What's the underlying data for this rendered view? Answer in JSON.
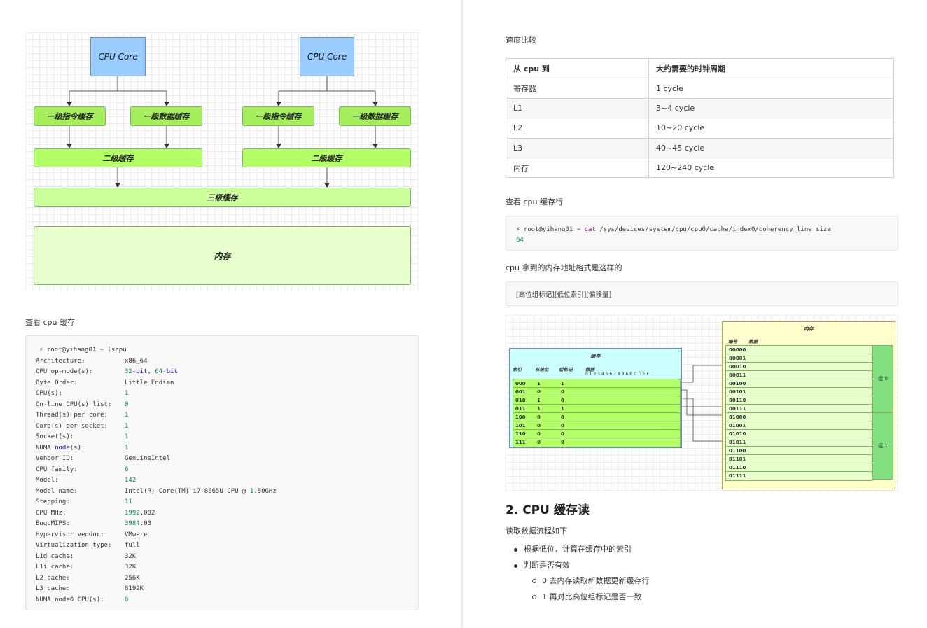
{
  "left": {
    "diagram": {
      "cpu_core": "CPU Core",
      "l1i": "一级指令缓存",
      "l1d": "一级数据缓存",
      "l2": "二级缓存",
      "l3": "三级缓存",
      "memory": "内存"
    },
    "caption": "查看 cpu 缓存",
    "lscpu": {
      "prompt": "⚡ root@yihang01 ~ lscpu",
      "rows": [
        [
          "Architecture:",
          "x86_64"
        ],
        [
          "CPU op-mode(s):",
          "32-bit, 64-bit"
        ],
        [
          "Byte Order:",
          "Little Endian"
        ],
        [
          "CPU(s):",
          "1"
        ],
        [
          "On-line CPU(s) list:",
          "0"
        ],
        [
          "Thread(s) per core:",
          "1"
        ],
        [
          "Core(s) per socket:",
          "1"
        ],
        [
          "Socket(s):",
          "1"
        ],
        [
          "NUMA node(s):",
          "1"
        ],
        [
          "Vendor ID:",
          "GenuineIntel"
        ],
        [
          "CPU family:",
          "6"
        ],
        [
          "Model:",
          "142"
        ],
        [
          "Model name:",
          "Intel(R) Core(TM) i7-8565U CPU @ 1.80GHz"
        ],
        [
          "Stepping:",
          "11"
        ],
        [
          "CPU MHz:",
          "1992.002"
        ],
        [
          "BogoMIPS:",
          "3984.00"
        ],
        [
          "Hypervisor vendor:",
          "VMware"
        ],
        [
          "Virtualization type:",
          "full"
        ],
        [
          "L1d cache:",
          "32K"
        ],
        [
          "L1i cache:",
          "32K"
        ],
        [
          "L2 cache:",
          "256K"
        ],
        [
          "L3 cache:",
          "8192K"
        ],
        [
          "NUMA node0 CPU(s):",
          "0"
        ]
      ]
    }
  },
  "right": {
    "speed_caption": "速度比较",
    "speed_table": {
      "headers": [
        "从 cpu 到",
        "大约需要的时钟周期"
      ],
      "rows": [
        [
          "寄存器",
          "1 cycle"
        ],
        [
          "L1",
          "3~4 cycle"
        ],
        [
          "L2",
          "10~20 cycle"
        ],
        [
          "L3",
          "40~45 cycle"
        ],
        [
          "内存",
          "120~240 cycle"
        ]
      ]
    },
    "cacheline_caption": "查看 cpu 缓存行",
    "cacheline_cmd_prompt": "⚡ root@yihang01 ~ ",
    "cacheline_cmd_cat": "cat",
    "cacheline_cmd_path": " /sys/devices/system/cpu/cpu0/cache/index0/coherency_line_size",
    "cacheline_output": "64",
    "addr_caption": "cpu 拿到的内存地址格式是这样的",
    "addr_format": "[高位组标记][低位索引][偏移量]",
    "cache_diagram": {
      "cache_title": "缓存",
      "col_index": "索引",
      "col_valid": "有效位",
      "col_tag": "组标记",
      "col_data": "数据",
      "data_bytes": "0 1 2 3 4 5 6 7 8 9 A B C D E F ...",
      "rows": [
        [
          "000",
          "1",
          "1"
        ],
        [
          "001",
          "0",
          "0"
        ],
        [
          "010",
          "1",
          "0"
        ],
        [
          "011",
          "1",
          "1"
        ],
        [
          "100",
          "0",
          "0"
        ],
        [
          "101",
          "0",
          "0"
        ],
        [
          "110",
          "0",
          "0"
        ],
        [
          "111",
          "0",
          "0"
        ]
      ],
      "mem_title": "内存",
      "mem_col_num": "编号",
      "mem_col_data": "数据",
      "mem_rows": [
        "00000",
        "00001",
        "00010",
        "00011",
        "00100",
        "00101",
        "00110",
        "00111",
        "01000",
        "01001",
        "01010",
        "01011",
        "01100",
        "01101",
        "01110",
        "01111"
      ],
      "group0": "组 0",
      "group1": "组 1"
    },
    "section_title": "2. CPU 缓存读",
    "section_intro": "读取数据流程如下",
    "bullets": [
      "根据低位，计算在缓存中的索引",
      "判断是否有效"
    ],
    "sub_bullets": [
      "0 去内存读取新数据更新缓存行",
      "1 再对比高位组标记是否一致"
    ]
  }
}
